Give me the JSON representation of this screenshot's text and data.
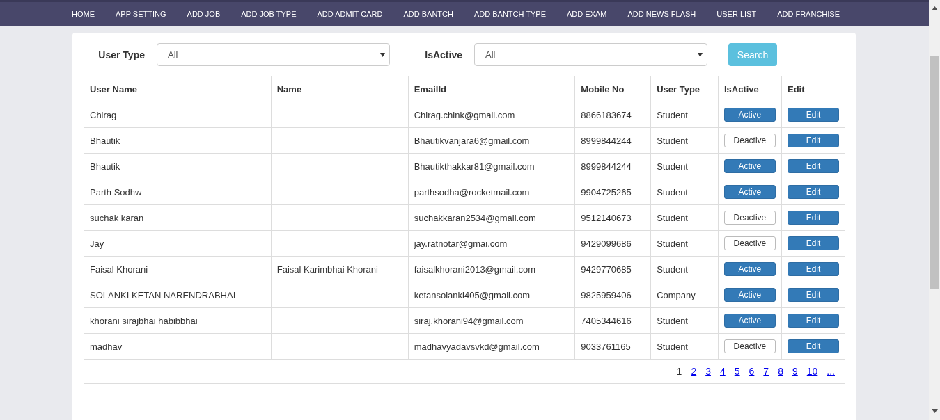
{
  "nav": [
    "HOME",
    "APP SETTING",
    "ADD JOB",
    "ADD JOB TYPE",
    "ADD ADMIT CARD",
    "ADD BANTCH",
    "ADD BANTCH TYPE",
    "ADD EXAM",
    "ADD NEWS FLASH",
    "USER LIST",
    "ADD FRANCHISE"
  ],
  "filters": [
    {
      "label": "User Type",
      "value": "All"
    },
    {
      "label": "IsActive",
      "value": "All"
    }
  ],
  "search_button": "Search",
  "table": {
    "columns": [
      "User Name",
      "Name",
      "EmailId",
      "Mobile No",
      "User Type",
      "IsActive",
      "Edit"
    ],
    "rows": [
      {
        "user_name": "Chirag",
        "name": "",
        "email": "Chirag.chink@gmail.com",
        "mobile": "8866183674",
        "user_type": "Student",
        "status": "Active",
        "active": true,
        "edit": "Edit"
      },
      {
        "user_name": "Bhautik",
        "name": "",
        "email": "Bhautikvanjara6@gmail.com",
        "mobile": "8999844244",
        "user_type": "Student",
        "status": "Deactive",
        "active": false,
        "edit": "Edit"
      },
      {
        "user_name": "Bhautik",
        "name": "",
        "email": "Bhautikthakkar81@gmail.com",
        "mobile": "8999844244",
        "user_type": "Student",
        "status": "Active",
        "active": true,
        "edit": "Edit"
      },
      {
        "user_name": "Parth Sodhw",
        "name": "",
        "email": "parthsodha@rocketmail.com",
        "mobile": "9904725265",
        "user_type": "Student",
        "status": "Active",
        "active": true,
        "edit": "Edit"
      },
      {
        "user_name": "suchak karan",
        "name": "",
        "email": "suchakkaran2534@gmail.com",
        "mobile": "9512140673",
        "user_type": "Student",
        "status": "Deactive",
        "active": false,
        "edit": "Edit"
      },
      {
        "user_name": "Jay",
        "name": "",
        "email": "jay.ratnotar@gmai.com",
        "mobile": "9429099686",
        "user_type": "Student",
        "status": "Deactive",
        "active": false,
        "edit": "Edit"
      },
      {
        "user_name": "Faisal Khorani",
        "name": "Faisal Karimbhai Khorani",
        "email": "faisalkhorani2013@gmail.com",
        "mobile": "9429770685",
        "user_type": "Student",
        "status": "Active",
        "active": true,
        "edit": "Edit"
      },
      {
        "user_name": "SOLANKI KETAN NARENDRABHAI",
        "name": "",
        "email": "ketansolanki405@gmail.com",
        "mobile": "9825959406",
        "user_type": "Company",
        "status": "Active",
        "active": true,
        "edit": "Edit"
      },
      {
        "user_name": "khorani sirajbhai habibbhai",
        "name": "",
        "email": "siraj.khorani94@gmail.com",
        "mobile": "7405344616",
        "user_type": "Student",
        "status": "Active",
        "active": true,
        "edit": "Edit"
      },
      {
        "user_name": "madhav",
        "name": "",
        "email": "madhavyadavsvkd@gmail.com",
        "mobile": "9033761165",
        "user_type": "Student",
        "status": "Deactive",
        "active": false,
        "edit": "Edit"
      }
    ]
  },
  "pages": [
    {
      "label": "1",
      "selected": true
    },
    {
      "label": "2",
      "selected": false
    },
    {
      "label": "3",
      "selected": false
    },
    {
      "label": "4",
      "selected": false
    },
    {
      "label": "5",
      "selected": false
    },
    {
      "label": "6",
      "selected": false
    },
    {
      "label": "7",
      "selected": false
    },
    {
      "label": "8",
      "selected": false
    },
    {
      "label": "9",
      "selected": false
    },
    {
      "label": "10",
      "selected": false
    },
    {
      "label": "...",
      "selected": false
    }
  ]
}
